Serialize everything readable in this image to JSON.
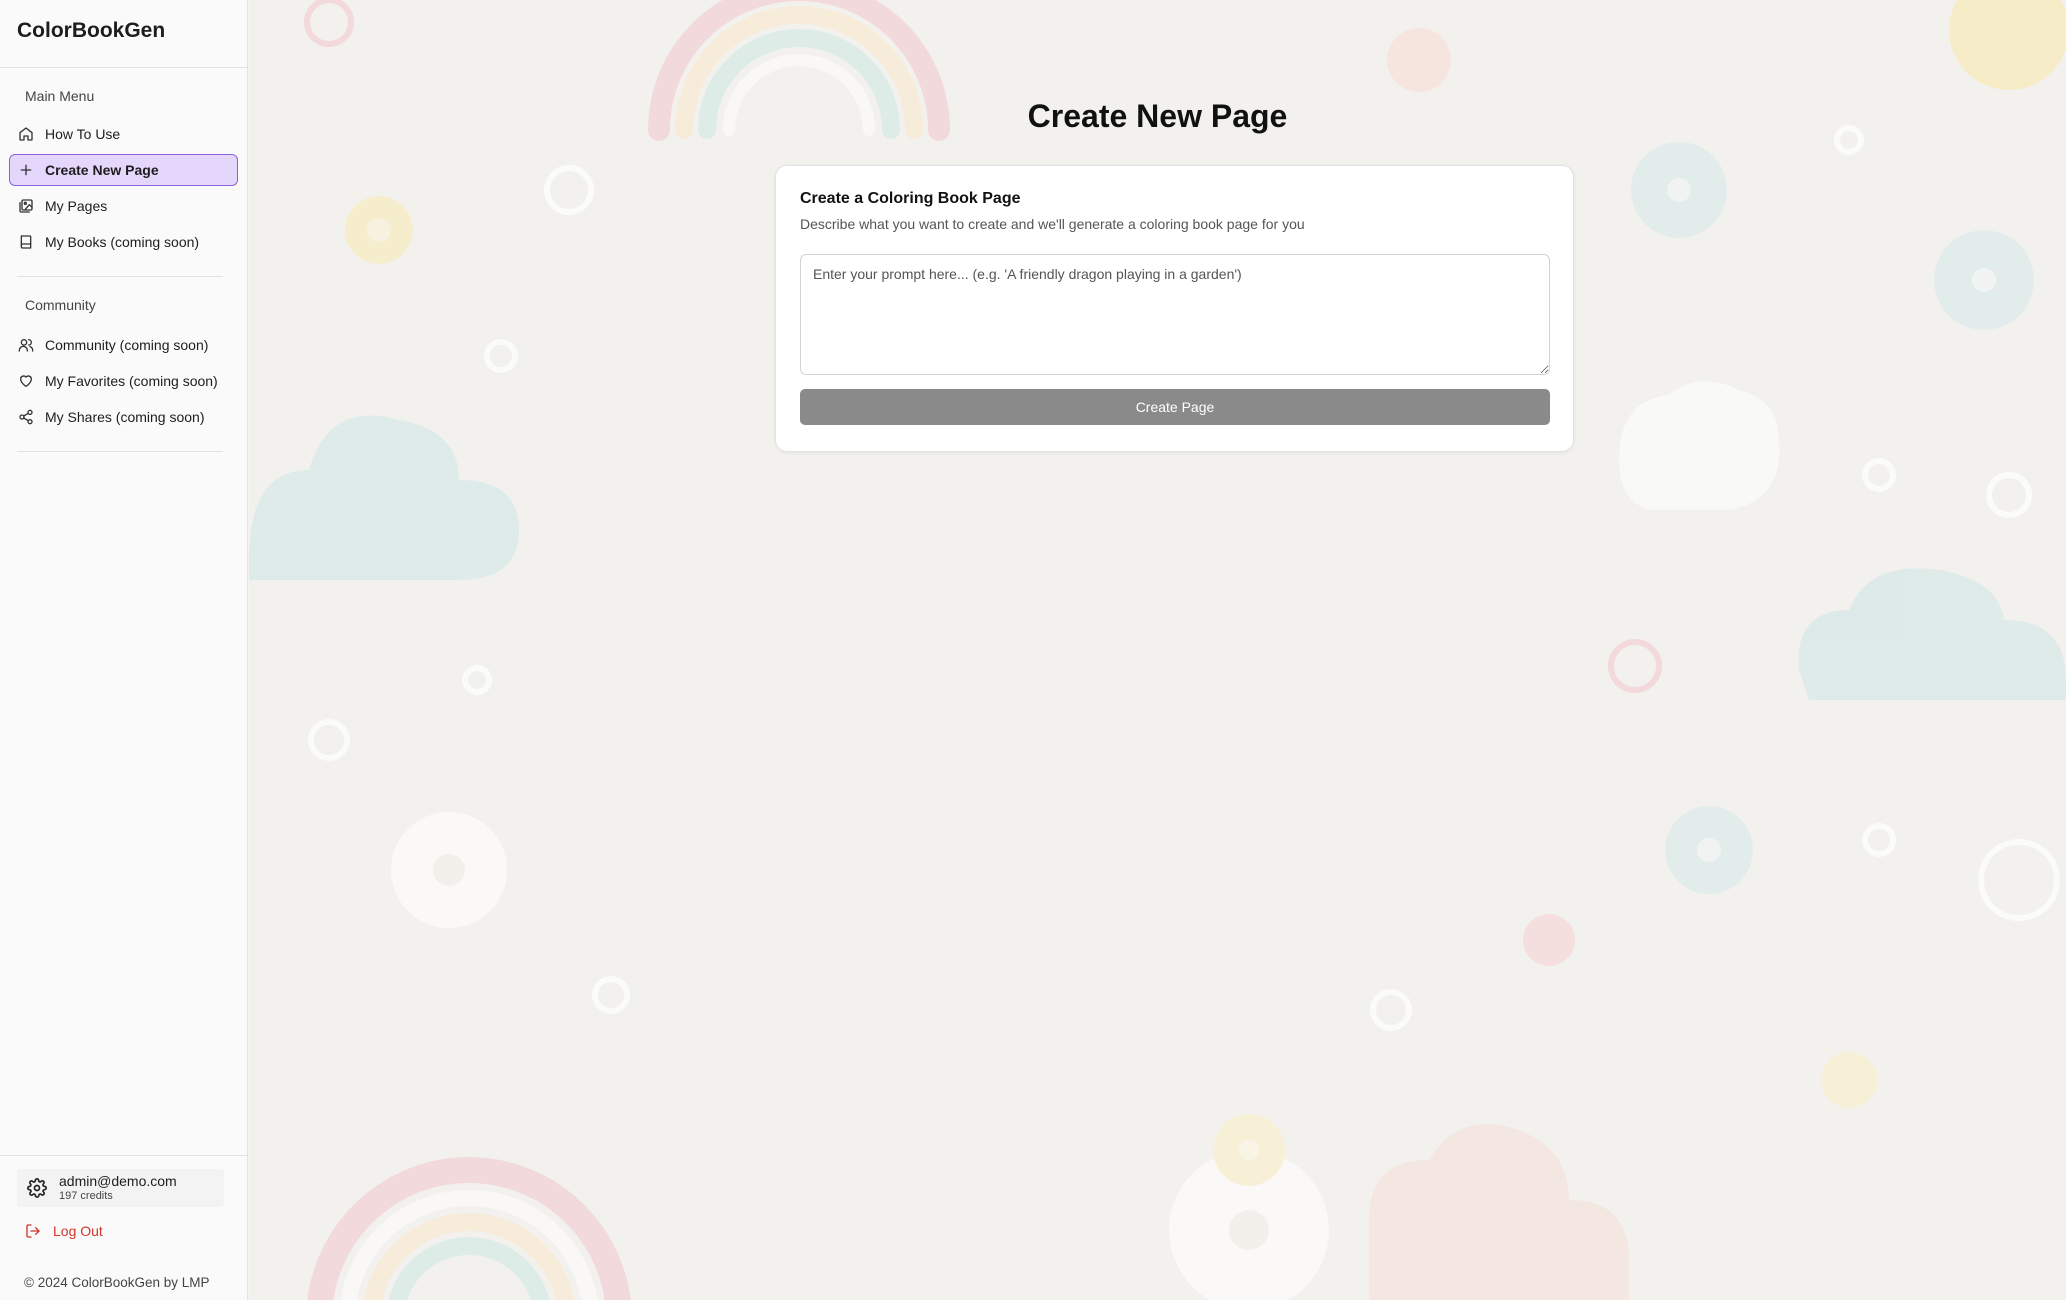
{
  "app": {
    "name": "ColorBookGen"
  },
  "sidebar": {
    "main_menu_label": "Main Menu",
    "main_items": [
      {
        "label": "How To Use",
        "icon": "home-icon",
        "active": false
      },
      {
        "label": "Create New Page",
        "icon": "plus-icon",
        "active": true
      },
      {
        "label": "My Pages",
        "icon": "images-icon",
        "active": false
      },
      {
        "label": "My Books (coming soon)",
        "icon": "book-icon",
        "active": false
      }
    ],
    "community_label": "Community",
    "community_items": [
      {
        "label": "Community (coming soon)",
        "icon": "users-icon"
      },
      {
        "label": "My Favorites (coming soon)",
        "icon": "heart-icon"
      },
      {
        "label": "My Shares (coming soon)",
        "icon": "share-icon"
      }
    ],
    "user": {
      "email": "admin@demo.com",
      "credits": "197 credits"
    },
    "logout_label": "Log Out",
    "copyright": "© 2024 ColorBookGen by LMP"
  },
  "main": {
    "title": "Create New Page",
    "card": {
      "title": "Create a Coloring Book Page",
      "description": "Describe what you want to create and we'll generate a coloring book page for you",
      "prompt_placeholder": "Enter your prompt here... (e.g. 'A friendly dragon playing in a garden')",
      "prompt_value": "",
      "button_label": "Create Page"
    }
  },
  "colors": {
    "accent_bg": "#e5d7fb",
    "accent_border": "#8b63d6",
    "logout": "#d0342c",
    "button_disabled": "#8a8a8a"
  }
}
